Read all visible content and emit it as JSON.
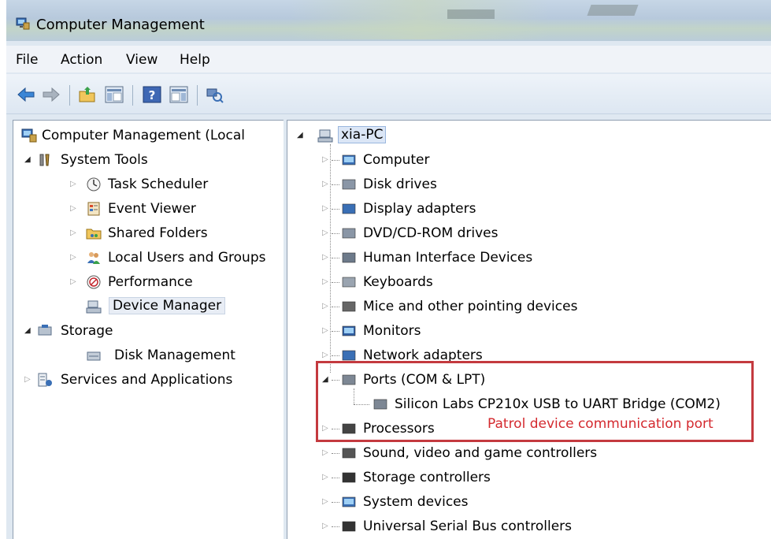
{
  "window": {
    "title": "Computer Management",
    "icon": "computer-management-icon"
  },
  "menu": [
    "File",
    "Action",
    "View",
    "Help"
  ],
  "toolbar": {
    "buttons": [
      "back-arrow-icon",
      "forward-arrow-icon",
      "up-folder-icon",
      "show-hide-console-tree-icon",
      "help-icon",
      "show-hide-action-pane-icon",
      "scan-hardware-icon"
    ]
  },
  "left_tree": {
    "root": "Computer Management (Local",
    "items": [
      {
        "label": "System Tools",
        "icon": "system-tools-icon"
      },
      {
        "label": "Task Scheduler",
        "icon": "clock-icon"
      },
      {
        "label": "Event Viewer",
        "icon": "event-viewer-icon"
      },
      {
        "label": "Shared Folders",
        "icon": "shared-folder-icon"
      },
      {
        "label": "Local Users and Groups",
        "icon": "users-icon"
      },
      {
        "label": "Performance",
        "icon": "performance-icon"
      },
      {
        "label": "Device Manager",
        "icon": "device-manager-icon"
      },
      {
        "label": "Storage",
        "icon": "storage-icon"
      },
      {
        "label": "Disk Management",
        "icon": "disk-icon"
      },
      {
        "label": "Services and Applications",
        "icon": "services-icon"
      }
    ]
  },
  "device_tree": {
    "root": "xia-PC",
    "categories": [
      "Computer",
      "Disk drives",
      "Display adapters",
      "DVD/CD-ROM drives",
      "Human Interface Devices",
      "Keyboards",
      "Mice and other pointing devices",
      "Monitors",
      "Network adapters",
      "Ports (COM & LPT)",
      "Silicon Labs CP210x USB to UART Bridge (COM2)",
      "Processors",
      "Sound, video and game controllers",
      "Storage controllers",
      "System devices",
      "Universal Serial Bus controllers"
    ]
  },
  "annotation": {
    "text": "Patrol device communication port",
    "color": "#d42a2f"
  }
}
